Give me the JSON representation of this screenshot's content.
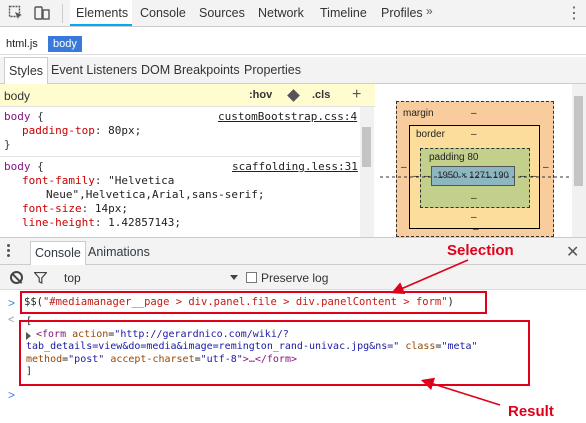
{
  "main_tabs": [
    "Elements",
    "Console",
    "Sources",
    "Network",
    "Timeline",
    "Profiles"
  ],
  "more_tabs": "»",
  "close_glyph": "⋮",
  "breadcrumb": {
    "html": "html.js",
    "body": "body"
  },
  "sidebar_tabs": [
    "Styles",
    "Event Listeners",
    "DOM Breakpoints",
    "Properties"
  ],
  "styles_filter": {
    "text": "body",
    "hov": ":hov",
    "cls": ".cls",
    "add": "+"
  },
  "rules": {
    "r1": {
      "selector": "body",
      "brace_open": " {",
      "prop": "padding-top",
      "value": "80px;",
      "source": "customBootstrap.css:4",
      "close": "}"
    },
    "r2": {
      "selector": "body",
      "brace_open": " {",
      "source": "scaffolding.less:31",
      "ff_prop": "font-family",
      "ff_val1": "\"Helvetica",
      "ff_val2": "Neue\",Helvetica,Arial,sans-serif;",
      "fs_prop": "font-size",
      "fs_val": "14px;",
      "lh_prop": "line-height",
      "lh_val": "1.42857143;"
    }
  },
  "box_model": {
    "margin_label": "margin",
    "margin_top": "–",
    "margin_bottom": "–",
    "margin_left": "–",
    "margin_right": "–",
    "border_label": "border",
    "border_top": "–",
    "border_bottom": "–",
    "border_left": "–",
    "border_right": "–",
    "padding_label": "padding 80",
    "padding_bottom": "–",
    "padding_left": "–",
    "padding_right": "–",
    "content": "1950 × 1271.190"
  },
  "drawer": {
    "tabs": [
      "Console",
      "Animations"
    ],
    "close": "✕"
  },
  "console_toolbar": {
    "context": "top",
    "preserve_log": "Preserve log"
  },
  "console": {
    "prompt": ">",
    "command_prefix": "$$(",
    "command_string": "\"#mediamanager__page > div.panel.file > div.panelContent > form\"",
    "command_suffix": ")",
    "return_marker": "<",
    "array_open": "[",
    "line1_tag_open": "<form",
    "line1_attr": "action",
    "line1_val": "\"http://gerardnico.com/wiki/?",
    "line2_val": "tab_details=view&do=media&image=remington_rand-univac.jpg&ns=\"",
    "line2_attr": "class",
    "line2_attr_val": "\"meta\"",
    "line3_attr1": "method",
    "line3_val1": "\"post\"",
    "line3_attr2": "accept-charset",
    "line3_val2": "\"utf-8\"",
    "line3_tail": ">…</form>",
    "array_close": "]",
    "empty_prompt": ">"
  },
  "annotations": {
    "selection": "Selection",
    "result": "Result"
  },
  "colors": {
    "accent": "#03a9f4",
    "annotation": "#e0001a",
    "breadcrumb_selected": "#3879d9"
  }
}
